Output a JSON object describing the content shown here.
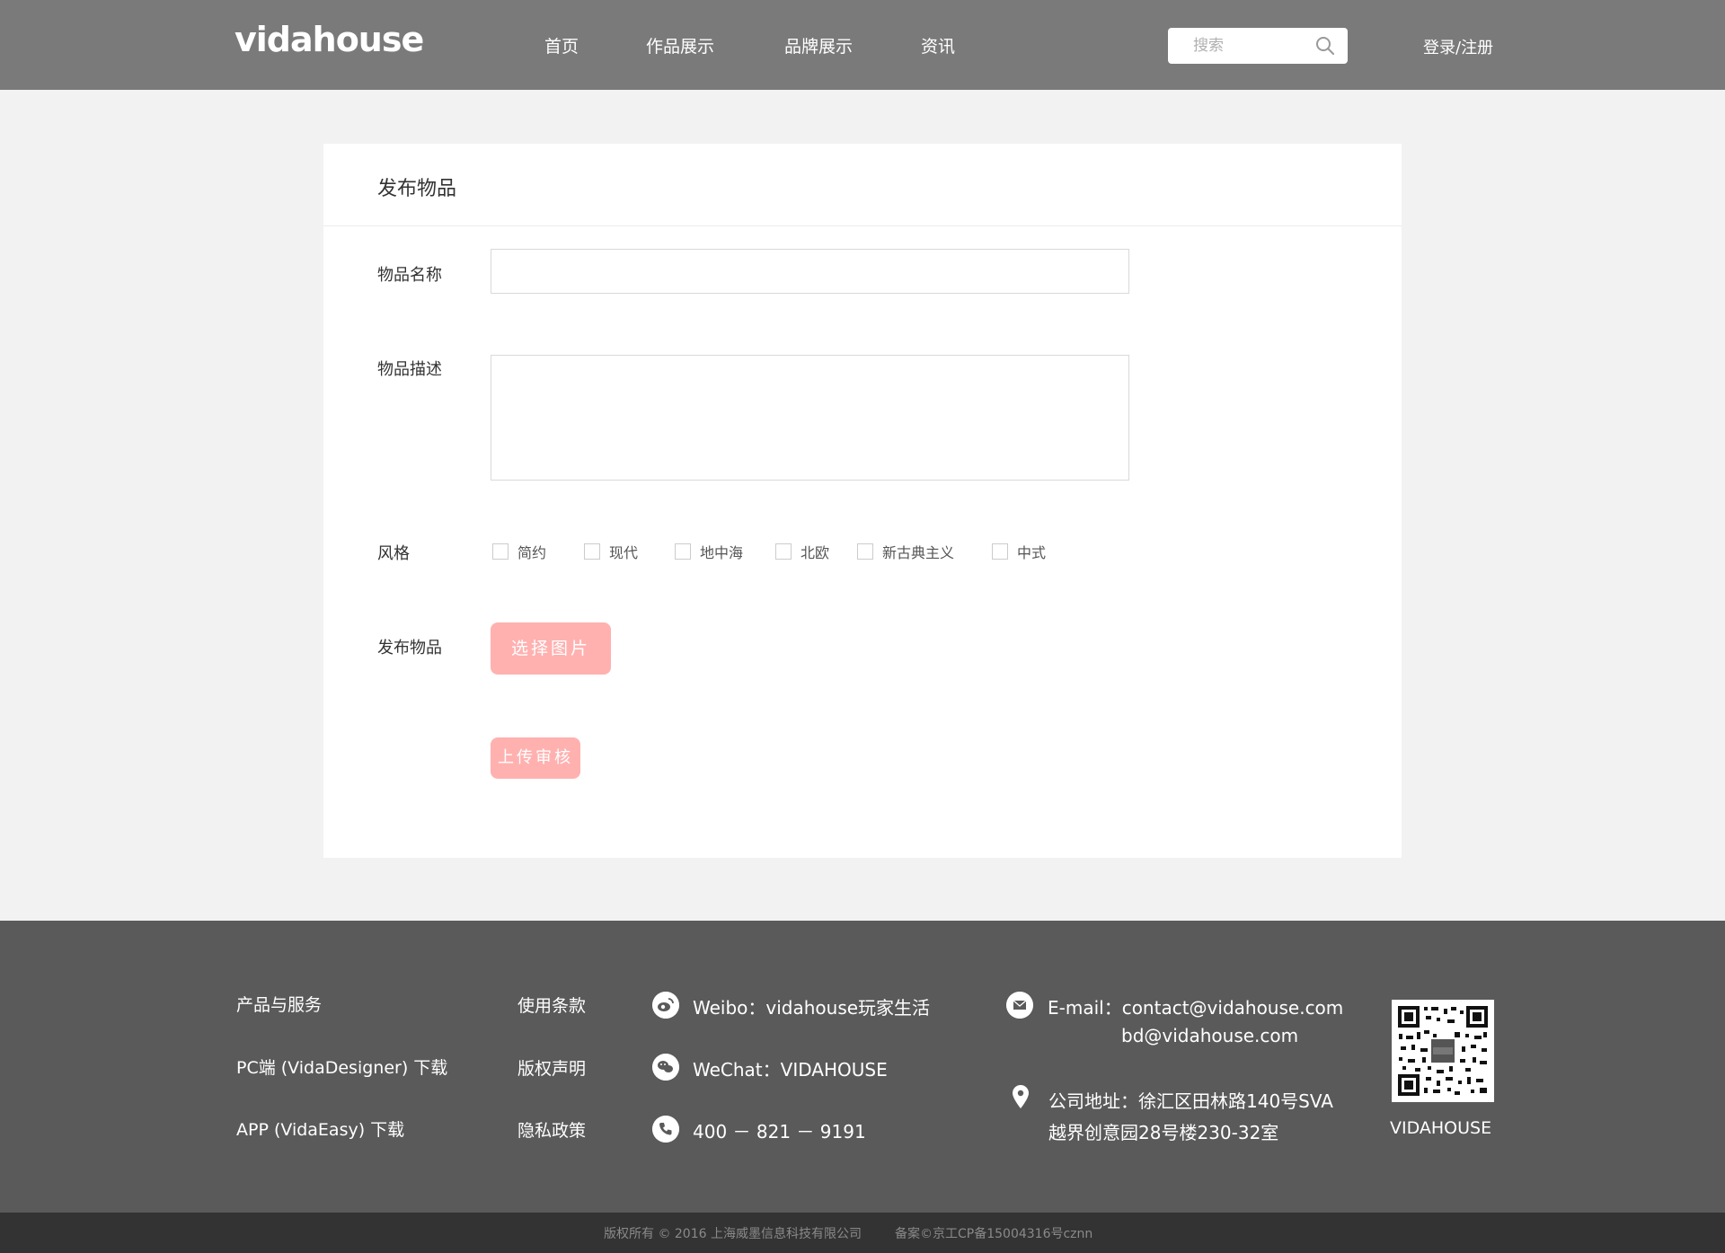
{
  "header": {
    "logo": "vidahouse",
    "nav": [
      "首页",
      "作品展示",
      "品牌展示",
      "资讯"
    ],
    "search_placeholder": "搜索",
    "login": "登录/注册"
  },
  "form": {
    "title": "发布物品",
    "name_label": "物品名称",
    "name_value": "",
    "desc_label": "物品描述",
    "desc_value": "",
    "style_label": "风格",
    "styles": [
      "简约",
      "现代",
      "地中海",
      "北欧",
      "新古典主义",
      "中式"
    ],
    "publish_label": "发布物品",
    "choose_image": "选择图片",
    "upload_review": "上传审核"
  },
  "footer": {
    "col1": [
      "产品与服务",
      "PC端 (VidaDesigner) 下载",
      "APP (VidaEasy) 下载"
    ],
    "col2": [
      "使用条款",
      "版权声明",
      "隐私政策"
    ],
    "weibo": "Weibo：vidahouse玩家生活",
    "wechat": "WeChat：VIDAHOUSE",
    "phone": "400 － 821 － 9191",
    "email_line1": "E-mail：contact@vidahouse.com",
    "email_line2": "bd@vidahouse.com",
    "address_line1": "公司地址：徐汇区田林路140号SVA",
    "address_line2": "越界创意园28号楼230-32室",
    "qr_label": "VIDAHOUSE",
    "copyright": "版权所有 © 2016 上海威墨信息科技有限公司",
    "icp": "备案©京工CP备15004316号cznn"
  },
  "icons": [
    "search-icon",
    "weibo-icon",
    "wechat-icon",
    "phone-icon",
    "mail-icon",
    "location-icon",
    "qr-code"
  ],
  "colors": {
    "header_bg": "#7a7a7a",
    "footer_bg": "#5a5a5a",
    "bottom_bar_bg": "#333333",
    "accent_pink": "#ffb1b0",
    "page_bg": "#f2f2f2"
  }
}
